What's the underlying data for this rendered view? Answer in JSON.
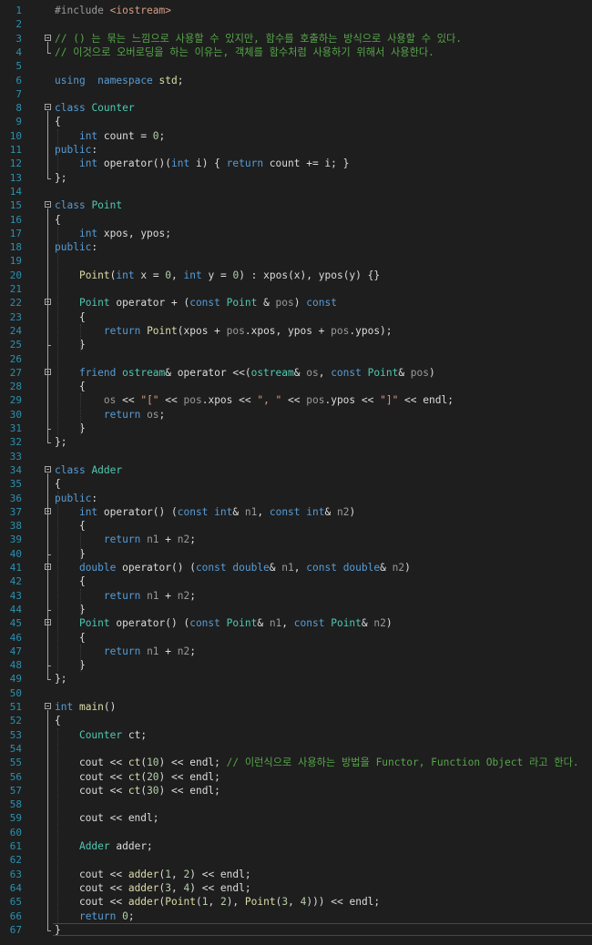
{
  "editor": {
    "lines": [
      {
        "n": "1",
        "t": [
          [
            "pp",
            "#include "
          ],
          [
            "st",
            "<iostream>"
          ]
        ]
      },
      {
        "n": "2",
        "t": []
      },
      {
        "n": "3",
        "t": [
          [
            "cm",
            "// () 는 묶는 느낌으로 사용할 수 있지만, 함수를 호출하는 방식으로 사용할 수 있다."
          ]
        ]
      },
      {
        "n": "4",
        "t": [
          [
            "cm",
            "// 이것으로 오버로딩을 하는 이유는, 객체를 함수처럼 사용하기 위해서 사용한다."
          ]
        ]
      },
      {
        "n": "5",
        "t": []
      },
      {
        "n": "6",
        "t": [
          [
            "kw",
            "using"
          ],
          [
            "",
            "  "
          ],
          [
            "kw",
            "namespace"
          ],
          [
            "",
            " "
          ],
          [
            "fn",
            "std"
          ],
          [
            "",
            ";"
          ]
        ]
      },
      {
        "n": "7",
        "t": []
      },
      {
        "n": "8",
        "t": [
          [
            "kw",
            "class"
          ],
          [
            "",
            " "
          ],
          [
            "ty",
            "Counter"
          ]
        ]
      },
      {
        "n": "9",
        "t": [
          [
            "",
            "{"
          ]
        ]
      },
      {
        "n": "10",
        "t": [
          [
            "",
            "    "
          ],
          [
            "kw",
            "int"
          ],
          [
            "",
            " count = "
          ],
          [
            "nm",
            "0"
          ],
          [
            "",
            ";"
          ]
        ]
      },
      {
        "n": "11",
        "t": [
          [
            "kw",
            "public"
          ],
          [
            "",
            ":"
          ]
        ]
      },
      {
        "n": "12",
        "t": [
          [
            "",
            "    "
          ],
          [
            "kw",
            "int"
          ],
          [
            "",
            " operator()("
          ],
          [
            "kw",
            "int"
          ],
          [
            "",
            " i) { "
          ],
          [
            "kw",
            "return"
          ],
          [
            "",
            " count += i; }"
          ]
        ]
      },
      {
        "n": "13",
        "t": [
          [
            "",
            "};"
          ]
        ]
      },
      {
        "n": "14",
        "t": []
      },
      {
        "n": "15",
        "t": [
          [
            "kw",
            "class"
          ],
          [
            "",
            " "
          ],
          [
            "ty",
            "Point"
          ]
        ]
      },
      {
        "n": "16",
        "t": [
          [
            "",
            "{"
          ]
        ]
      },
      {
        "n": "17",
        "t": [
          [
            "",
            "    "
          ],
          [
            "kw",
            "int"
          ],
          [
            "",
            " xpos, ypos;"
          ]
        ]
      },
      {
        "n": "18",
        "t": [
          [
            "kw",
            "public"
          ],
          [
            "",
            ":"
          ]
        ]
      },
      {
        "n": "19",
        "t": []
      },
      {
        "n": "20",
        "t": [
          [
            "",
            "    "
          ],
          [
            "fn",
            "Point"
          ],
          [
            "",
            "("
          ],
          [
            "kw",
            "int"
          ],
          [
            "",
            " x = "
          ],
          [
            "nm",
            "0"
          ],
          [
            "",
            ", "
          ],
          [
            "kw",
            "int"
          ],
          [
            "",
            " y = "
          ],
          [
            "nm",
            "0"
          ],
          [
            "",
            ") : xpos(x), ypos(y) {}"
          ]
        ]
      },
      {
        "n": "21",
        "t": []
      },
      {
        "n": "22",
        "t": [
          [
            "",
            "    "
          ],
          [
            "ty",
            "Point"
          ],
          [
            "",
            " operator + ("
          ],
          [
            "kw",
            "const"
          ],
          [
            "",
            " "
          ],
          [
            "ty",
            "Point"
          ],
          [
            "",
            " & "
          ],
          [
            "pa",
            "pos"
          ],
          [
            "",
            ") "
          ],
          [
            "kw",
            "const"
          ]
        ]
      },
      {
        "n": "23",
        "t": [
          [
            "",
            "    {"
          ]
        ]
      },
      {
        "n": "24",
        "t": [
          [
            "",
            "        "
          ],
          [
            "kw",
            "return"
          ],
          [
            "",
            " "
          ],
          [
            "fn",
            "Point"
          ],
          [
            "",
            "(xpos + "
          ],
          [
            "pa",
            "pos"
          ],
          [
            "",
            ".xpos, ypos + "
          ],
          [
            "pa",
            "pos"
          ],
          [
            "",
            ".ypos);"
          ]
        ]
      },
      {
        "n": "25",
        "t": [
          [
            "",
            "    }"
          ]
        ]
      },
      {
        "n": "26",
        "t": []
      },
      {
        "n": "27",
        "t": [
          [
            "",
            "    "
          ],
          [
            "kw",
            "friend"
          ],
          [
            "",
            " "
          ],
          [
            "ty",
            "ostream"
          ],
          [
            "",
            "& operator <<("
          ],
          [
            "ty",
            "ostream"
          ],
          [
            "",
            "& "
          ],
          [
            "pa",
            "os"
          ],
          [
            "",
            ", "
          ],
          [
            "kw",
            "const"
          ],
          [
            "",
            " "
          ],
          [
            "ty",
            "Point"
          ],
          [
            "",
            "& "
          ],
          [
            "pa",
            "pos"
          ],
          [
            "",
            ")"
          ]
        ]
      },
      {
        "n": "28",
        "t": [
          [
            "",
            "    {"
          ]
        ]
      },
      {
        "n": "29",
        "t": [
          [
            "",
            "        "
          ],
          [
            "pa",
            "os"
          ],
          [
            "",
            " << "
          ],
          [
            "st",
            "\"[\""
          ],
          [
            "",
            " << "
          ],
          [
            "pa",
            "pos"
          ],
          [
            "",
            ".xpos << "
          ],
          [
            "st",
            "\", \""
          ],
          [
            "",
            " << "
          ],
          [
            "pa",
            "pos"
          ],
          [
            "",
            ".ypos << "
          ],
          [
            "st",
            "\"]\""
          ],
          [
            "",
            " << endl;"
          ]
        ]
      },
      {
        "n": "30",
        "t": [
          [
            "",
            "        "
          ],
          [
            "kw",
            "return"
          ],
          [
            "",
            " "
          ],
          [
            "pa",
            "os"
          ],
          [
            "",
            ";"
          ]
        ]
      },
      {
        "n": "31",
        "t": [
          [
            "",
            "    }"
          ]
        ]
      },
      {
        "n": "32",
        "t": [
          [
            "",
            "};"
          ]
        ]
      },
      {
        "n": "33",
        "t": []
      },
      {
        "n": "34",
        "t": [
          [
            "kw",
            "class"
          ],
          [
            "",
            " "
          ],
          [
            "ty",
            "Adder"
          ]
        ]
      },
      {
        "n": "35",
        "t": [
          [
            "",
            "{"
          ]
        ]
      },
      {
        "n": "36",
        "t": [
          [
            "kw",
            "public"
          ],
          [
            "",
            ":"
          ]
        ]
      },
      {
        "n": "37",
        "t": [
          [
            "",
            "    "
          ],
          [
            "kw",
            "int"
          ],
          [
            "",
            " operator() ("
          ],
          [
            "kw",
            "const"
          ],
          [
            "",
            " "
          ],
          [
            "kw",
            "int"
          ],
          [
            "",
            "& "
          ],
          [
            "pa",
            "n1"
          ],
          [
            "",
            ", "
          ],
          [
            "kw",
            "const"
          ],
          [
            "",
            " "
          ],
          [
            "kw",
            "int"
          ],
          [
            "",
            "& "
          ],
          [
            "pa",
            "n2"
          ],
          [
            "",
            ")"
          ]
        ]
      },
      {
        "n": "38",
        "t": [
          [
            "",
            "    {"
          ]
        ]
      },
      {
        "n": "39",
        "t": [
          [
            "",
            "        "
          ],
          [
            "kw",
            "return"
          ],
          [
            "",
            " "
          ],
          [
            "pa",
            "n1"
          ],
          [
            "",
            " + "
          ],
          [
            "pa",
            "n2"
          ],
          [
            "",
            ";"
          ]
        ]
      },
      {
        "n": "40",
        "t": [
          [
            "",
            "    }"
          ]
        ]
      },
      {
        "n": "41",
        "t": [
          [
            "",
            "    "
          ],
          [
            "kw",
            "double"
          ],
          [
            "",
            " operator() ("
          ],
          [
            "kw",
            "const"
          ],
          [
            "",
            " "
          ],
          [
            "kw",
            "double"
          ],
          [
            "",
            "& "
          ],
          [
            "pa",
            "n1"
          ],
          [
            "",
            ", "
          ],
          [
            "kw",
            "const"
          ],
          [
            "",
            " "
          ],
          [
            "kw",
            "double"
          ],
          [
            "",
            "& "
          ],
          [
            "pa",
            "n2"
          ],
          [
            "",
            ")"
          ]
        ]
      },
      {
        "n": "42",
        "t": [
          [
            "",
            "    {"
          ]
        ]
      },
      {
        "n": "43",
        "t": [
          [
            "",
            "        "
          ],
          [
            "kw",
            "return"
          ],
          [
            "",
            " "
          ],
          [
            "pa",
            "n1"
          ],
          [
            "",
            " + "
          ],
          [
            "pa",
            "n2"
          ],
          [
            "",
            ";"
          ]
        ]
      },
      {
        "n": "44",
        "t": [
          [
            "",
            "    }"
          ]
        ]
      },
      {
        "n": "45",
        "t": [
          [
            "",
            "    "
          ],
          [
            "ty",
            "Point"
          ],
          [
            "",
            " operator() ("
          ],
          [
            "kw",
            "const"
          ],
          [
            "",
            " "
          ],
          [
            "ty",
            "Point"
          ],
          [
            "",
            "& "
          ],
          [
            "pa",
            "n1"
          ],
          [
            "",
            ", "
          ],
          [
            "kw",
            "const"
          ],
          [
            "",
            " "
          ],
          [
            "ty",
            "Point"
          ],
          [
            "",
            "& "
          ],
          [
            "pa",
            "n2"
          ],
          [
            "",
            ")"
          ]
        ]
      },
      {
        "n": "46",
        "t": [
          [
            "",
            "    {"
          ]
        ]
      },
      {
        "n": "47",
        "t": [
          [
            "",
            "        "
          ],
          [
            "kw",
            "return"
          ],
          [
            "",
            " "
          ],
          [
            "pa",
            "n1"
          ],
          [
            "",
            " + "
          ],
          [
            "pa",
            "n2"
          ],
          [
            "",
            ";"
          ]
        ]
      },
      {
        "n": "48",
        "t": [
          [
            "",
            "    }"
          ]
        ]
      },
      {
        "n": "49",
        "t": [
          [
            "",
            "};"
          ]
        ]
      },
      {
        "n": "50",
        "t": []
      },
      {
        "n": "51",
        "t": [
          [
            "kw",
            "int"
          ],
          [
            "",
            " "
          ],
          [
            "fn",
            "main"
          ],
          [
            "",
            "()"
          ]
        ]
      },
      {
        "n": "52",
        "t": [
          [
            "",
            "{"
          ]
        ]
      },
      {
        "n": "53",
        "t": [
          [
            "",
            "    "
          ],
          [
            "ty",
            "Counter"
          ],
          [
            "",
            " ct;"
          ]
        ]
      },
      {
        "n": "54",
        "t": []
      },
      {
        "n": "55",
        "t": [
          [
            "",
            "    cout << "
          ],
          [
            "fn",
            "ct"
          ],
          [
            "",
            "("
          ],
          [
            "nm",
            "10"
          ],
          [
            "",
            ") << endl; "
          ],
          [
            "cm",
            "// 이런식으로 사용하는 방법을 Functor, Function Object 라고 한다."
          ]
        ]
      },
      {
        "n": "56",
        "t": [
          [
            "",
            "    cout << "
          ],
          [
            "fn",
            "ct"
          ],
          [
            "",
            "("
          ],
          [
            "nm",
            "20"
          ],
          [
            "",
            ") << endl;"
          ]
        ]
      },
      {
        "n": "57",
        "t": [
          [
            "",
            "    cout << "
          ],
          [
            "fn",
            "ct"
          ],
          [
            "",
            "("
          ],
          [
            "nm",
            "30"
          ],
          [
            "",
            ") << endl;"
          ]
        ]
      },
      {
        "n": "58",
        "t": []
      },
      {
        "n": "59",
        "t": [
          [
            "",
            "    cout << endl;"
          ]
        ]
      },
      {
        "n": "60",
        "t": []
      },
      {
        "n": "61",
        "t": [
          [
            "",
            "    "
          ],
          [
            "ty",
            "Adder"
          ],
          [
            "",
            " adder;"
          ]
        ]
      },
      {
        "n": "62",
        "t": []
      },
      {
        "n": "63",
        "t": [
          [
            "",
            "    cout << "
          ],
          [
            "fn",
            "adder"
          ],
          [
            "",
            "("
          ],
          [
            "nm",
            "1"
          ],
          [
            "",
            ", "
          ],
          [
            "nm",
            "2"
          ],
          [
            "",
            ") << endl;"
          ]
        ]
      },
      {
        "n": "64",
        "t": [
          [
            "",
            "    cout << "
          ],
          [
            "fn",
            "adder"
          ],
          [
            "",
            "("
          ],
          [
            "nm",
            "3"
          ],
          [
            "",
            ", "
          ],
          [
            "nm",
            "4"
          ],
          [
            "",
            ") << endl;"
          ]
        ]
      },
      {
        "n": "65",
        "t": [
          [
            "",
            "    cout << "
          ],
          [
            "fn",
            "adder"
          ],
          [
            "",
            "("
          ],
          [
            "fn",
            "Point"
          ],
          [
            "",
            "("
          ],
          [
            "nm",
            "1"
          ],
          [
            "",
            ", "
          ],
          [
            "nm",
            "2"
          ],
          [
            "",
            "), "
          ],
          [
            "fn",
            "Point"
          ],
          [
            "",
            "("
          ],
          [
            "nm",
            "3"
          ],
          [
            "",
            ", "
          ],
          [
            "nm",
            "4"
          ],
          [
            "",
            "))) << endl;"
          ]
        ]
      },
      {
        "n": "66",
        "t": [
          [
            "",
            "    "
          ],
          [
            "kw",
            "return"
          ],
          [
            "",
            " "
          ],
          [
            "nm",
            "0"
          ],
          [
            "",
            ";"
          ]
        ]
      },
      {
        "n": "67",
        "t": [
          [
            "",
            "}"
          ]
        ]
      }
    ]
  }
}
